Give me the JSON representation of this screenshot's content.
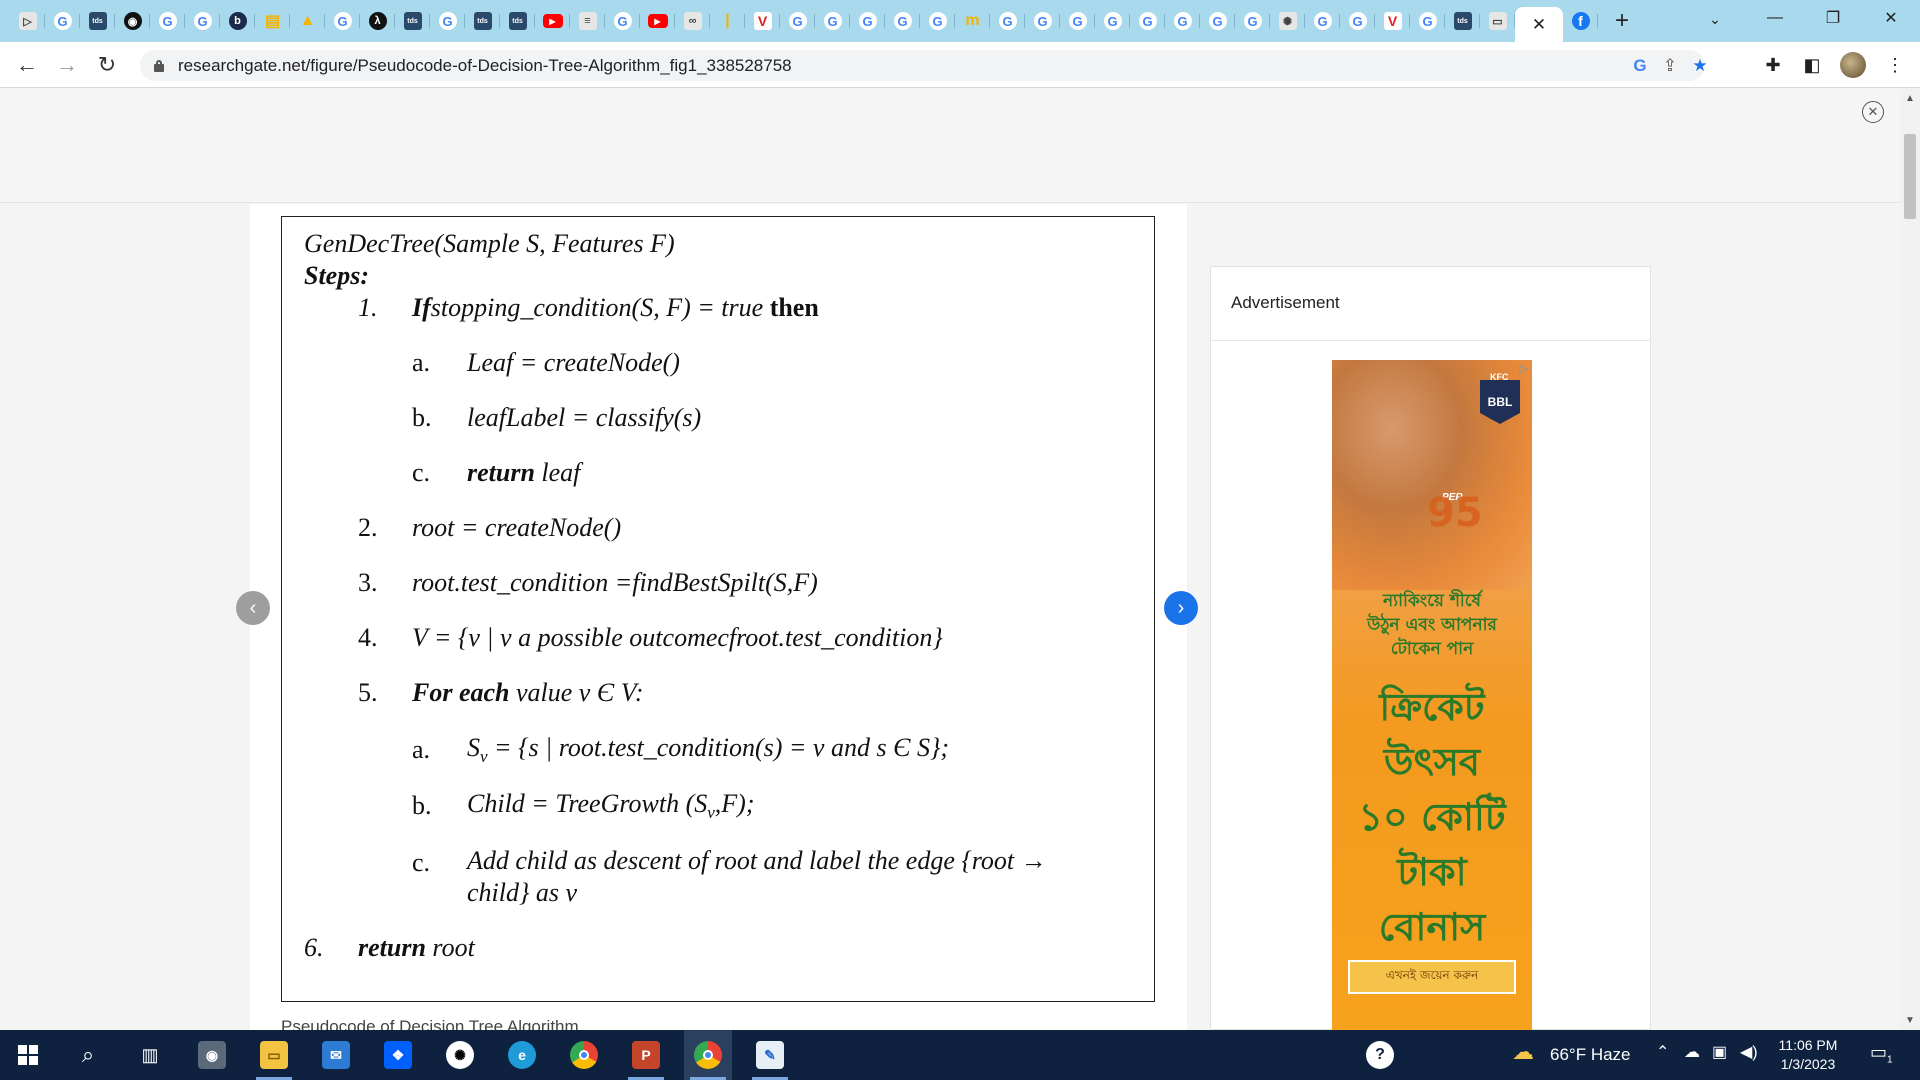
{
  "browser": {
    "tabs": [
      {
        "icon": "ps-play-icon",
        "glyph": "▷",
        "cls": "fav misc"
      },
      {
        "icon": "google-icon",
        "glyph": "G",
        "cls": "fav g"
      },
      {
        "icon": "tds-icon",
        "glyph": "tds",
        "cls": "fav tds"
      },
      {
        "icon": "github-icon",
        "glyph": "◉",
        "cls": "fav gh"
      },
      {
        "icon": "google-icon",
        "glyph": "G",
        "cls": "fav g"
      },
      {
        "icon": "google-icon",
        "glyph": "G",
        "cls": "fav g"
      },
      {
        "icon": "b-icon",
        "glyph": "b",
        "cls": "fav b"
      },
      {
        "icon": "slides-icon",
        "glyph": "▤",
        "cls": "fav drive"
      },
      {
        "icon": "drive-icon",
        "glyph": "▲",
        "cls": "fav drive"
      },
      {
        "icon": "google-icon",
        "glyph": "G",
        "cls": "fav g"
      },
      {
        "icon": "lambda-icon",
        "glyph": "λ",
        "cls": "fav gh"
      },
      {
        "icon": "tds-icon",
        "glyph": "tds",
        "cls": "fav tds"
      },
      {
        "icon": "google-icon",
        "glyph": "G",
        "cls": "fav g"
      },
      {
        "icon": "tds-icon",
        "glyph": "tds",
        "cls": "fav tds"
      },
      {
        "icon": "tds-icon",
        "glyph": "tds",
        "cls": "fav tds"
      },
      {
        "icon": "youtube-icon",
        "glyph": "▶",
        "cls": "fav yt"
      },
      {
        "icon": "settings-sliders-icon",
        "glyph": "≡",
        "cls": "fav misc"
      },
      {
        "icon": "google-icon",
        "glyph": "G",
        "cls": "fav g"
      },
      {
        "icon": "youtube-icon",
        "glyph": "▶",
        "cls": "fav yt"
      },
      {
        "icon": "infinity-icon",
        "glyph": "∞",
        "cls": "fav misc"
      },
      {
        "icon": "bookmark-icon",
        "glyph": "|",
        "cls": "fav drive"
      },
      {
        "icon": "vivaldi-icon",
        "glyph": "V",
        "cls": "fav v"
      },
      {
        "icon": "google-icon",
        "glyph": "G",
        "cls": "fav g"
      },
      {
        "icon": "google-icon",
        "glyph": "G",
        "cls": "fav g"
      },
      {
        "icon": "google-icon",
        "glyph": "G",
        "cls": "fav g"
      },
      {
        "icon": "google-icon",
        "glyph": "G",
        "cls": "fav g"
      },
      {
        "icon": "google-icon",
        "glyph": "G",
        "cls": "fav g"
      },
      {
        "icon": "pomodoro-icon",
        "glyph": "m",
        "cls": "fav drive"
      },
      {
        "icon": "google-icon",
        "glyph": "G",
        "cls": "fav g"
      },
      {
        "icon": "google-icon",
        "glyph": "G",
        "cls": "fav g"
      },
      {
        "icon": "google-icon",
        "glyph": "G",
        "cls": "fav g"
      },
      {
        "icon": "google-icon",
        "glyph": "G",
        "cls": "fav g"
      },
      {
        "icon": "google-icon",
        "glyph": "G",
        "cls": "fav g"
      },
      {
        "icon": "google-icon",
        "glyph": "G",
        "cls": "fav g"
      },
      {
        "icon": "google-icon",
        "glyph": "G",
        "cls": "fav g"
      },
      {
        "icon": "google-icon",
        "glyph": "G",
        "cls": "fav g"
      },
      {
        "icon": "openai-icon",
        "glyph": "✺",
        "cls": "fav misc"
      },
      {
        "icon": "google-icon",
        "glyph": "G",
        "cls": "fav g"
      },
      {
        "icon": "google-icon",
        "glyph": "G",
        "cls": "fav g"
      },
      {
        "icon": "vivaldi-icon",
        "glyph": "V",
        "cls": "fav v"
      },
      {
        "icon": "google-icon",
        "glyph": "G",
        "cls": "fav g"
      },
      {
        "icon": "tds-icon",
        "glyph": "tds",
        "cls": "fav tds"
      },
      {
        "icon": "page-icon",
        "glyph": "▭",
        "cls": "fav misc"
      }
    ],
    "active_tab_close": "✕",
    "facebook_glyph": "f",
    "new_tab": "+",
    "tab_search": "⌄",
    "window": {
      "minimize": "—",
      "restore": "❐",
      "close": "✕"
    },
    "nav": {
      "back": "←",
      "forward": "→",
      "reload": "↻"
    },
    "url": "researchgate.net/figure/Pseudocode-of-Decision-Tree-Algorithm_fig1_338528758",
    "omni": {
      "google": "G",
      "share": "⇪",
      "star": "★"
    },
    "toolbar": {
      "extensions": "✚",
      "sidepanel": "◧",
      "menu": "⋮"
    }
  },
  "page": {
    "close_banner": "✕",
    "prev": "‹",
    "next": "›",
    "caption": "Pseudocode of Decision Tree Algorithm",
    "pseudocode": {
      "header": "GenDecTree(Sample S, Features F)",
      "steps_label": "Steps:",
      "s1_num": "1.",
      "s1_if": "If",
      "s1_cond": "stopping_condition(S, F) = true",
      "s1_then": "then",
      "s1a_num": "a.",
      "s1a": "Leaf = createNode()",
      "s1b_num": "b.",
      "s1b": "leafLabel = classify(s)",
      "s1c_num": "c.",
      "s1c_ret": "return",
      "s1c_val": "leaf",
      "s2_num": "2.",
      "s2": "root = createNode()",
      "s3_num": "3.",
      "s3": "root.test_condition =findBestSpilt(S,F)",
      "s4_num": "4.",
      "s4": "V = {v | v a possible outcomecfroot.test_condition}",
      "s5_num": "5.",
      "s5_for": "For each",
      "s5_rest": "value v Є V:",
      "s5a_num": "a.",
      "s5a_s": "S",
      "s5a_sub": "v",
      "s5a_rest": "= {s | root.test_condition(s) = v and s Є S};",
      "s5b_num": "b.",
      "s5b_pre": "Child = TreeGrowth (S",
      "s5b_sub": "v",
      "s5b_post": ",F);",
      "s5c_num": "c.",
      "s5c_line1": "Add child as descent of root and label the edge {root →",
      "s5c_line2": "child} as v",
      "s6_num": "6.",
      "s6_ret": "return",
      "s6_val": "root"
    }
  },
  "ad": {
    "title": "Advertisement",
    "badge": "BBL",
    "kfc": "KFC",
    "choices": "▷",
    "jersey": "95",
    "jersey_tag": "PER",
    "line1": "ন্যাকিংয়ে শীর্ষে",
    "line2": "উঠুন এবং আপনার",
    "line3": "টোকেন পান",
    "big1": "ক্রিকেট",
    "big2": "উৎসব",
    "big3": "১০ কোটি",
    "big4": "টাকা",
    "big5": "বোনাস",
    "cta": "এখনই জয়েন করুন"
  },
  "taskbar": {
    "temp": "66°F  Haze",
    "time": "11:06 PM",
    "date": "1/3/2023",
    "notif_count": "1"
  }
}
